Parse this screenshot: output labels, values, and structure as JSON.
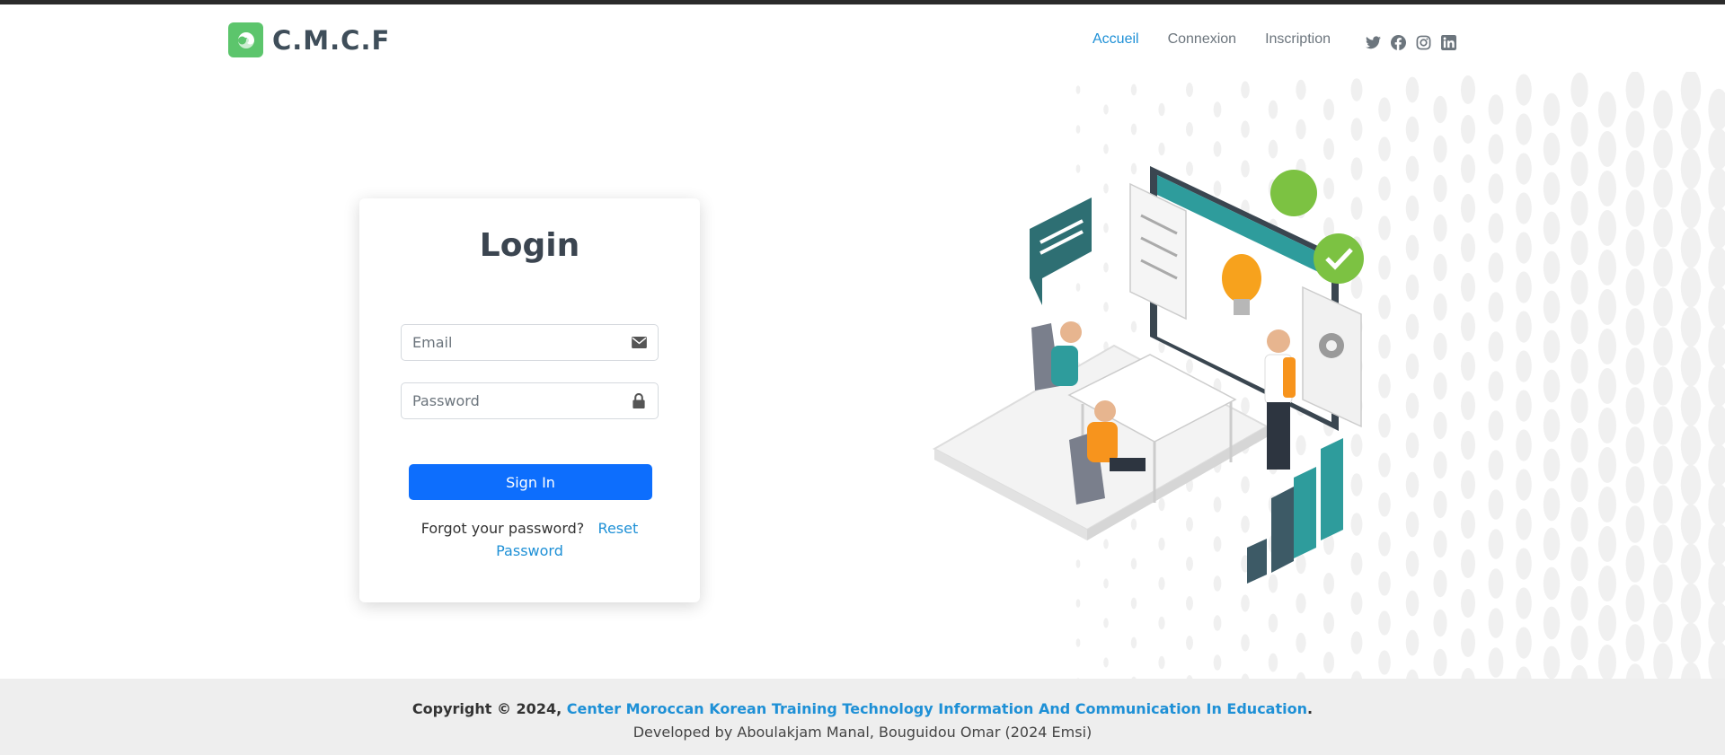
{
  "brand": {
    "name": "C.M.C.F",
    "logo_icon": "swirl-logo-icon",
    "logo_color": "#5cc56c"
  },
  "nav": {
    "items": [
      {
        "label": "Accueil",
        "active": true
      },
      {
        "label": "Connexion",
        "active": false
      },
      {
        "label": "Inscription",
        "active": false
      }
    ],
    "social_icons": [
      "twitter-icon",
      "facebook-icon",
      "instagram-icon",
      "linkedin-icon"
    ]
  },
  "login": {
    "title": "Login",
    "email_placeholder": "Email",
    "email_icon": "envelope-icon",
    "password_placeholder": "Password",
    "password_icon": "lock-icon",
    "submit_label": "Sign In",
    "forgot_text": "Forgot your password?",
    "reset_link": "Reset Password"
  },
  "footer": {
    "copyright_prefix": "Copyright © 2024,",
    "org_link": "Center Moroccan Korean Training Technology Information And Communication In Education",
    "copyright_suffix": ".",
    "developed_by": "Developed by Aboulakjam Manal, Bouguidou Omar (2024 Emsi)"
  },
  "colors": {
    "accent": "#0d6efd",
    "link": "#1e90d6",
    "footer_bg": "#eeeeee",
    "teal": "#2e9c9c",
    "orange": "#f7941d",
    "green": "#7cc242"
  }
}
